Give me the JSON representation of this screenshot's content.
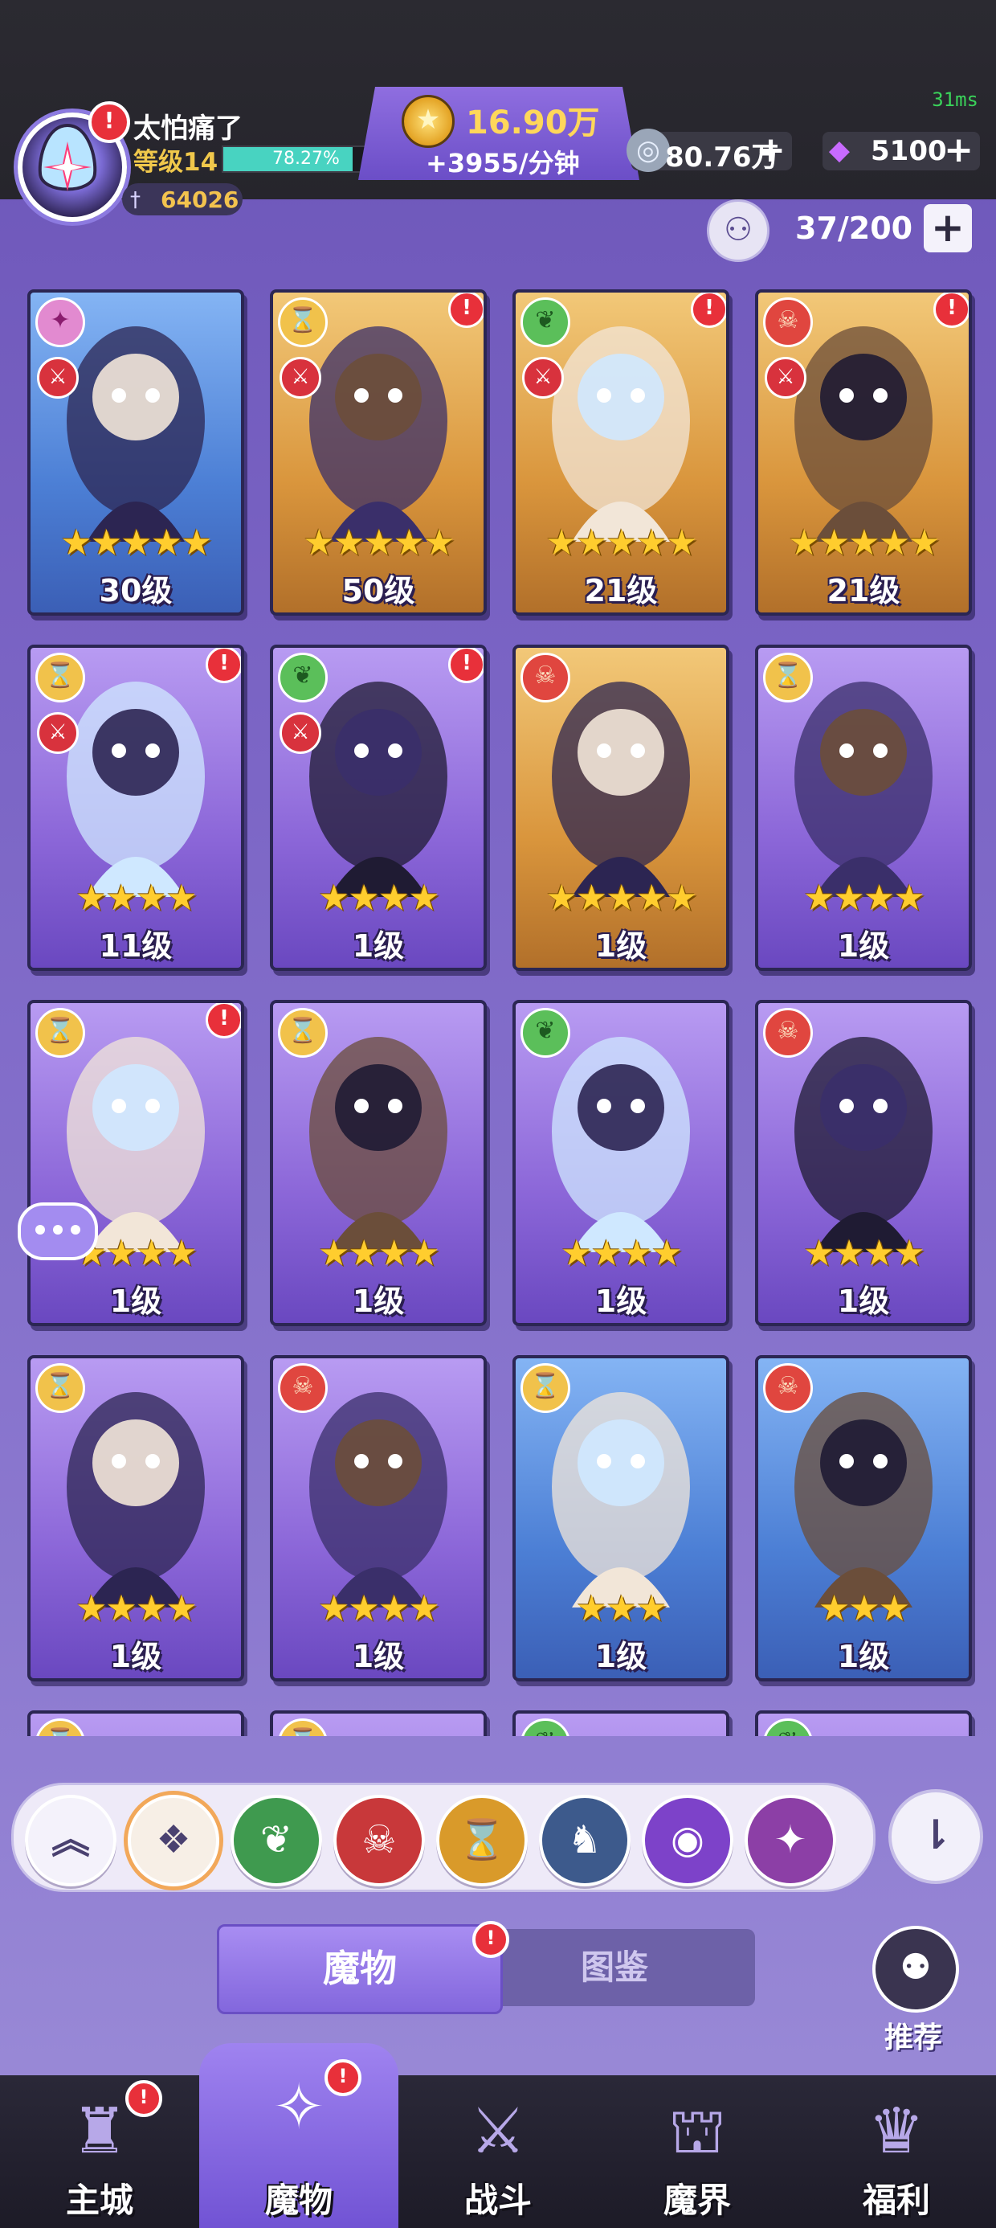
{
  "status": {
    "ping": "31ms"
  },
  "player": {
    "name": "太怕痛了",
    "level_label": "等级14",
    "xp_percent_label": "78.27%",
    "xp_fraction": 0.7827,
    "power": "64026"
  },
  "currency": {
    "gold": "16.90万",
    "gold_rate": "+3955/分钟",
    "silver": "80.76万",
    "gems": "5100",
    "plus_symbol": "+"
  },
  "roster": {
    "count": "37/200",
    "add_symbol": "+"
  },
  "colors": {
    "card_blue": "#4c7fd5",
    "card_gold": "#d9953c",
    "card_purple": "#8b66d8",
    "badge_red": "#e8303a",
    "gold_text": "#ffd75a"
  },
  "cards": [
    {
      "element": "void",
      "frame": "blue",
      "stars": "★★★★★",
      "level": "30级",
      "role_icon": "sword-icon",
      "new": false
    },
    {
      "element": "time",
      "frame": "gold",
      "stars": "★★★★★",
      "level": "50级",
      "role_icon": "sword-icon",
      "new": true
    },
    {
      "element": "nature",
      "frame": "gold",
      "stars": "★★★★★",
      "level": "21级",
      "role_icon": "sword-icon",
      "new": true
    },
    {
      "element": "demon",
      "frame": "gold",
      "stars": "★★★★★",
      "level": "21级",
      "role_icon": "sword-icon",
      "new": true
    },
    {
      "element": "time",
      "frame": "purple",
      "stars": "★★★★",
      "level": "11级",
      "role_icon": "sword-icon",
      "new": true
    },
    {
      "element": "nature",
      "frame": "purple",
      "stars": "★★★★",
      "level": "1级",
      "role_icon": "sword-icon",
      "new": true
    },
    {
      "element": "demon",
      "frame": "gold",
      "stars": "★★★★★",
      "level": "1级",
      "role_icon": "",
      "new": false
    },
    {
      "element": "time",
      "frame": "purple",
      "stars": "★★★★",
      "level": "1级",
      "role_icon": "",
      "new": false
    },
    {
      "element": "time",
      "frame": "purple",
      "stars": "★★★★",
      "level": "1级",
      "role_icon": "",
      "new": true
    },
    {
      "element": "time",
      "frame": "purple",
      "stars": "★★★★",
      "level": "1级",
      "role_icon": "",
      "new": false
    },
    {
      "element": "nature",
      "frame": "purple",
      "stars": "★★★★",
      "level": "1级",
      "role_icon": "",
      "new": false
    },
    {
      "element": "demon",
      "frame": "purple",
      "stars": "★★★★",
      "level": "1级",
      "role_icon": "",
      "new": false
    },
    {
      "element": "time",
      "frame": "purple",
      "stars": "★★★★",
      "level": "1级",
      "role_icon": "",
      "new": false
    },
    {
      "element": "demon",
      "frame": "purple",
      "stars": "★★★★",
      "level": "1级",
      "role_icon": "",
      "new": false
    },
    {
      "element": "time",
      "frame": "blue",
      "stars": "★★★",
      "level": "1级",
      "role_icon": "",
      "new": false
    },
    {
      "element": "demon",
      "frame": "blue",
      "stars": "★★★",
      "level": "1级",
      "role_icon": "",
      "new": false
    }
  ],
  "partial_row_elements": [
    "time",
    "time",
    "nature",
    "nature"
  ],
  "filters": [
    {
      "name": "collapse",
      "icon": "double-chevron-up-icon",
      "glyph": "︽",
      "color": "#f4f2fb"
    },
    {
      "name": "all",
      "icon": "diamond-grid-icon",
      "glyph": "❖",
      "color": "#f7efe6"
    },
    {
      "name": "nature",
      "icon": "leaf-icon",
      "glyph": "❦",
      "color": "#3f9a4f"
    },
    {
      "name": "demon",
      "icon": "demon-skull-icon",
      "glyph": "☠",
      "color": "#c8383a"
    },
    {
      "name": "time",
      "icon": "hourglass-icon",
      "glyph": "⌛",
      "color": "#d99a2a"
    },
    {
      "name": "dragon",
      "icon": "dragon-icon",
      "glyph": "♞",
      "color": "#3d5a8c"
    },
    {
      "name": "eye",
      "icon": "eye-icon",
      "glyph": "◉",
      "color": "#7d42c9"
    },
    {
      "name": "void",
      "icon": "swirl-icon",
      "glyph": "✦",
      "color": "#8c3fa6"
    }
  ],
  "sort_glyph": "⇂",
  "tabs": {
    "active": "魔物",
    "inactive": "图鉴"
  },
  "recommend": {
    "label": "推荐"
  },
  "nav": [
    {
      "label": "主城",
      "icon": "castle-icon",
      "glyph": "♜",
      "badge": true,
      "active": false
    },
    {
      "label": "魔物",
      "icon": "monster-flame-icon",
      "glyph": "✧",
      "badge": true,
      "active": true
    },
    {
      "label": "战斗",
      "icon": "sword-shield-icon",
      "glyph": "⚔",
      "badge": false,
      "active": false
    },
    {
      "label": "魔界",
      "icon": "lock-portal-icon",
      "glyph": "⛫",
      "badge": false,
      "active": false
    },
    {
      "label": "福利",
      "icon": "treasure-chest-icon",
      "glyph": "♛",
      "badge": false,
      "active": false
    }
  ],
  "badge_glyph": "!"
}
